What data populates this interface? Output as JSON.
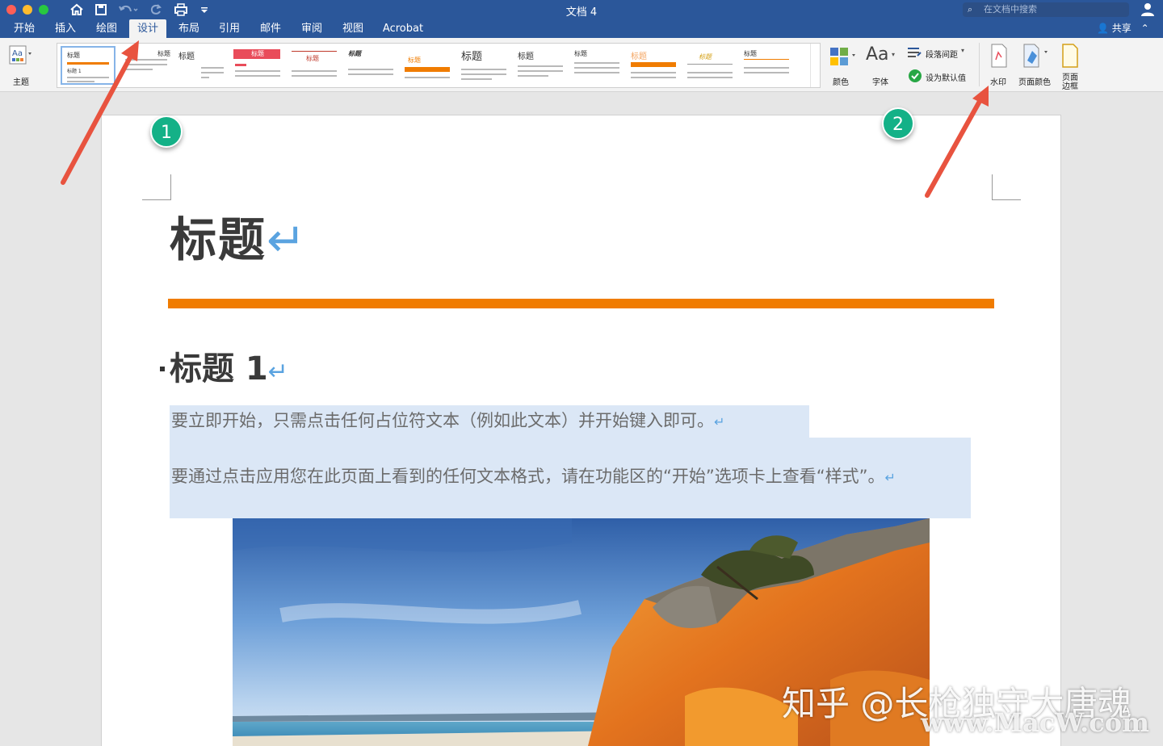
{
  "window": {
    "title": "文档 4",
    "search_placeholder": "在文档中搜索"
  },
  "tabs": [
    {
      "label": "开始"
    },
    {
      "label": "插入"
    },
    {
      "label": "绘图"
    },
    {
      "label": "设计",
      "active": true
    },
    {
      "label": "布局"
    },
    {
      "label": "引用"
    },
    {
      "label": "邮件"
    },
    {
      "label": "审阅"
    },
    {
      "label": "视图"
    },
    {
      "label": "Acrobat"
    }
  ],
  "share_label": "共享",
  "ribbon": {
    "theme_label": "主题",
    "gallery": [
      {
        "title": "标题",
        "heading": "标题 1"
      },
      {
        "title": "标题"
      },
      {
        "title": "标题"
      },
      {
        "title": "标题"
      },
      {
        "title": "标题"
      },
      {
        "title": "标题"
      },
      {
        "title": "标题"
      },
      {
        "title": "标题"
      },
      {
        "title": "标题"
      },
      {
        "title": "标题"
      },
      {
        "title": "标题"
      },
      {
        "title": "标题"
      },
      {
        "title": "标题"
      }
    ],
    "colors_label": "颜色",
    "fonts_label": "字体",
    "fonts_glyph": "Aa",
    "spacing_label": "段落间距",
    "set_default_label": "设为默认值",
    "watermark_label": "水印",
    "page_color_label": "页面颜色",
    "page_borders_label_1": "页面",
    "page_borders_label_2": "边框"
  },
  "document": {
    "title": "标题",
    "heading1": "标题 1",
    "para1": "要立即开始，只需点击任何占位符文本（例如此文本）并开始键入即可。",
    "para2": "要通过点击应用您在此页面上看到的任何文本格式，请在功能区的“开始”选项卡上查看“样式”。",
    "para_mark": "↵"
  },
  "annotations": {
    "badge1": "1",
    "badge2": "2"
  },
  "watermark": {
    "line1": "知乎 @长枪独守大唐魂",
    "line2": "www.MacW.com"
  },
  "colors": {
    "accent": "#2b579a",
    "orange_rule": "#f07c00",
    "badge": "#14b187",
    "arrow": "#e8533f"
  }
}
